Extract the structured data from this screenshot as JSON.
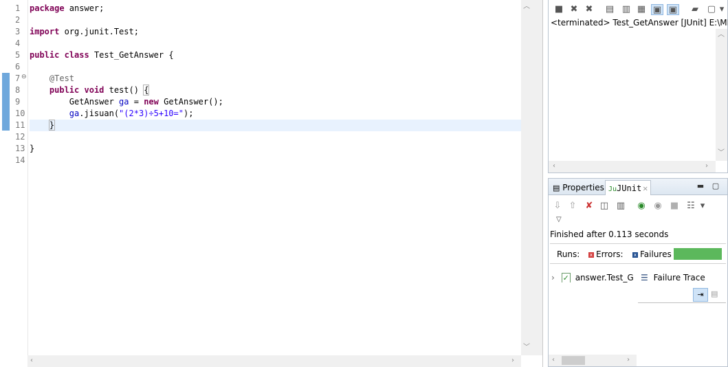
{
  "editor": {
    "line_numbers": [
      "1",
      "2",
      "3",
      "4",
      "5",
      "6",
      "7",
      "8",
      "9",
      "10",
      "11",
      "12",
      "13",
      "14"
    ],
    "lines": [
      {
        "parts": [
          {
            "t": "kw",
            "v": "package"
          },
          {
            "t": "txt",
            "v": " answer;"
          }
        ]
      },
      {
        "parts": []
      },
      {
        "parts": [
          {
            "t": "kw",
            "v": "import"
          },
          {
            "t": "txt",
            "v": " org.junit.Test;"
          }
        ]
      },
      {
        "parts": []
      },
      {
        "parts": [
          {
            "t": "kw",
            "v": "public"
          },
          {
            "t": "txt",
            "v": " "
          },
          {
            "t": "kw",
            "v": "class"
          },
          {
            "t": "txt",
            "v": " Test_GetAnswer {"
          }
        ]
      },
      {
        "parts": []
      },
      {
        "parts": [
          {
            "t": "txt",
            "v": "    "
          },
          {
            "t": "ann",
            "v": "@Test"
          }
        ]
      },
      {
        "parts": [
          {
            "t": "txt",
            "v": "    "
          },
          {
            "t": "kw",
            "v": "public"
          },
          {
            "t": "txt",
            "v": " "
          },
          {
            "t": "kw",
            "v": "void"
          },
          {
            "t": "txt",
            "v": " test() "
          },
          {
            "t": "box",
            "v": "{"
          }
        ]
      },
      {
        "parts": [
          {
            "t": "txt",
            "v": "        GetAnswer "
          },
          {
            "t": "var",
            "v": "ga"
          },
          {
            "t": "txt",
            "v": " = "
          },
          {
            "t": "kw",
            "v": "new"
          },
          {
            "t": "txt",
            "v": " GetAnswer();"
          }
        ]
      },
      {
        "parts": [
          {
            "t": "txt",
            "v": "        "
          },
          {
            "t": "var",
            "v": "ga"
          },
          {
            "t": "txt",
            "v": ".jisuan("
          },
          {
            "t": "str",
            "v": "\"(2*3)÷5+10=\""
          },
          {
            "t": "txt",
            "v": ");"
          }
        ]
      },
      {
        "parts": [
          {
            "t": "txt",
            "v": "    "
          },
          {
            "t": "box",
            "v": "}"
          },
          {
            "t": "caret",
            "v": ""
          }
        ],
        "current": true
      },
      {
        "parts": []
      },
      {
        "parts": [
          {
            "t": "txt",
            "v": "}"
          }
        ]
      },
      {
        "parts": []
      }
    ]
  },
  "console": {
    "label": "<terminated> Test_GetAnswer [JUnit] E:\\ME"
  },
  "junit": {
    "tab_properties": "Properties",
    "tab_junit": "JUnit",
    "finished": "Finished after 0.113 seconds",
    "runs_label": "Runs:",
    "errors_label": "Errors:",
    "failures_label": "Failures",
    "test_item": "answer.Test_G",
    "failure_trace": "Failure Trace",
    "status_color": "#5cb85c"
  },
  "icons": {
    "fold": "⊖",
    "tree_expand": "›",
    "trace": "☰"
  }
}
